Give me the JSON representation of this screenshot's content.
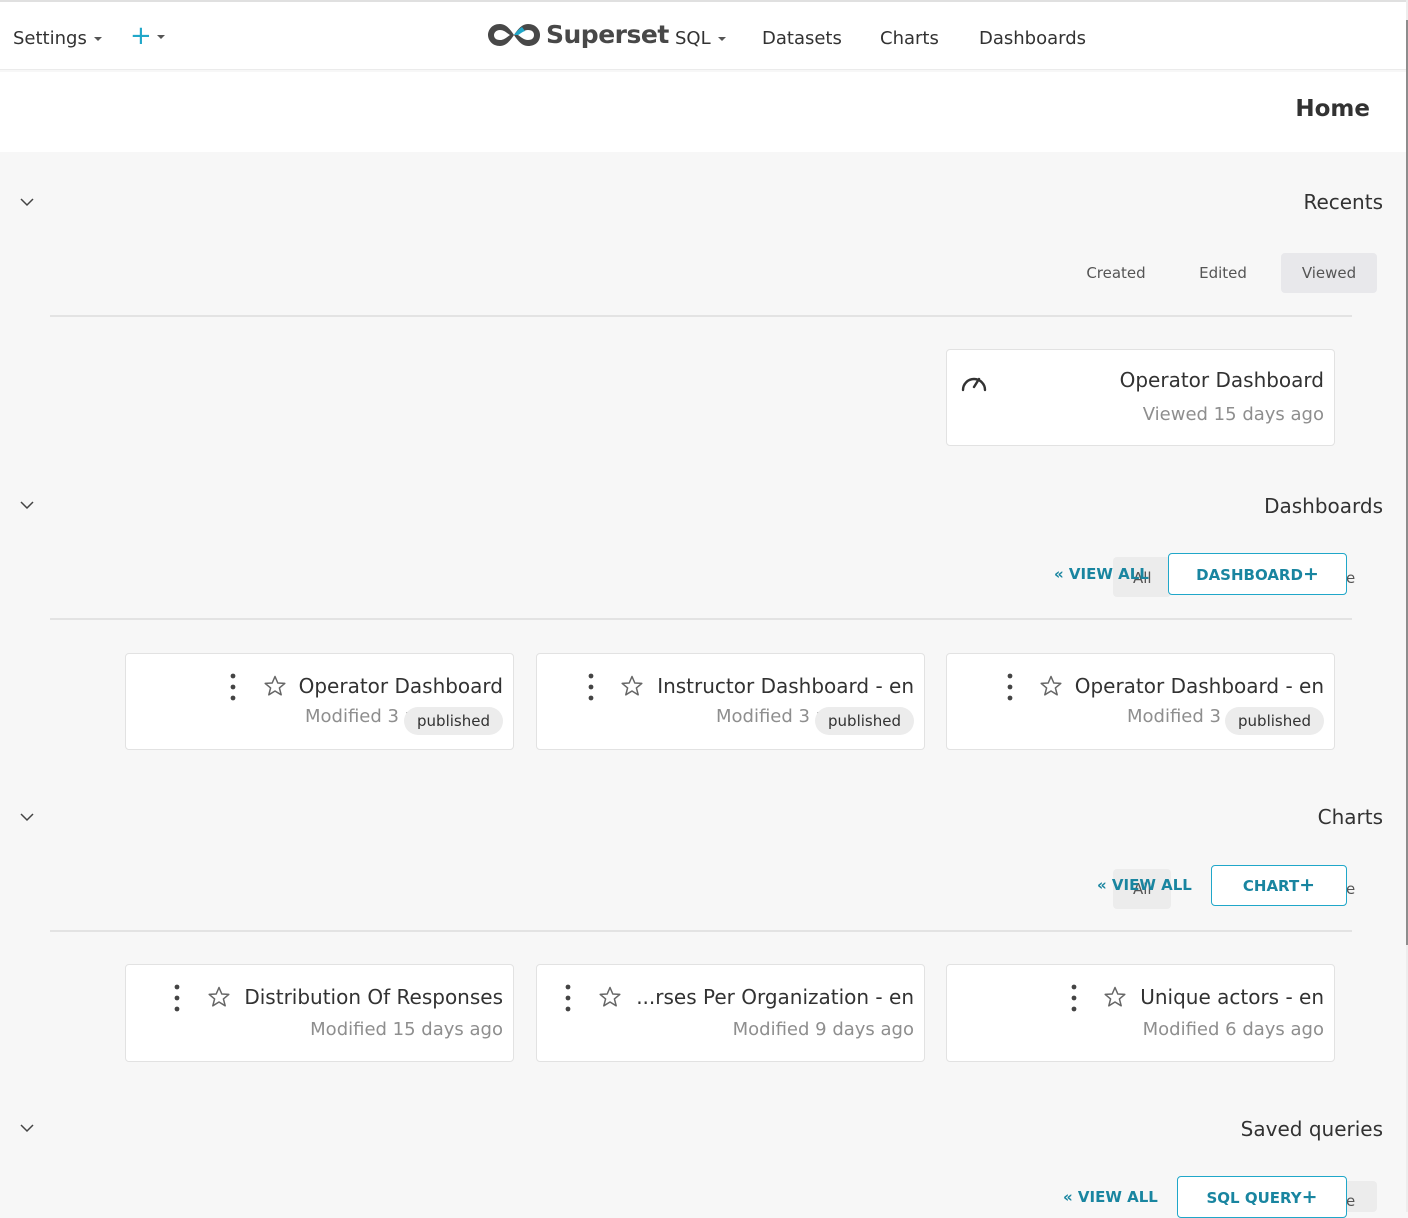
{
  "nav": {
    "settings": "Settings",
    "plus": "+",
    "brand": "Superset",
    "sql": "SQL",
    "datasets": "Datasets",
    "charts": "Charts",
    "dashboards": "Dashboards"
  },
  "page": {
    "title": "Home"
  },
  "recents": {
    "title": "Recents",
    "tabs": [
      "Created",
      "Edited",
      "Viewed"
    ],
    "active_tab": "Viewed",
    "card": {
      "title": "Operator Dashboard",
      "subtitle": "Viewed 15 days ago"
    }
  },
  "dashboards": {
    "title": "Dashboards",
    "view_all": "« VIEW ALL",
    "tab_all": "All",
    "new_button": "DASHBOARD",
    "cards": [
      {
        "title": "Operator Dashboard",
        "subtitle": "Modified 3 r",
        "badge": "published"
      },
      {
        "title": "Instructor Dashboard - en",
        "subtitle": "Modified 3 r",
        "badge": "published"
      },
      {
        "title": "Operator Dashboard - en",
        "subtitle": "Modified 3 r",
        "badge": "published"
      }
    ]
  },
  "charts": {
    "title": "Charts",
    "view_all": "« VIEW ALL",
    "tab_all": "All",
    "new_button": "CHART",
    "cards": [
      {
        "title": "Distribution Of Responses",
        "subtitle": "Modified 15 days ago"
      },
      {
        "title": "...rses Per Organization - en",
        "subtitle": "Modified 9 days ago"
      },
      {
        "title": "Unique actors - en",
        "subtitle": "Modified 6 days ago"
      }
    ]
  },
  "saved_queries": {
    "title": "Saved queries",
    "view_all": "« VIEW ALL",
    "new_button": "SQL QUERY"
  },
  "colors": {
    "accent": "#20a7c9",
    "accent_text": "#1985a0",
    "background": "#f7f7f7"
  }
}
